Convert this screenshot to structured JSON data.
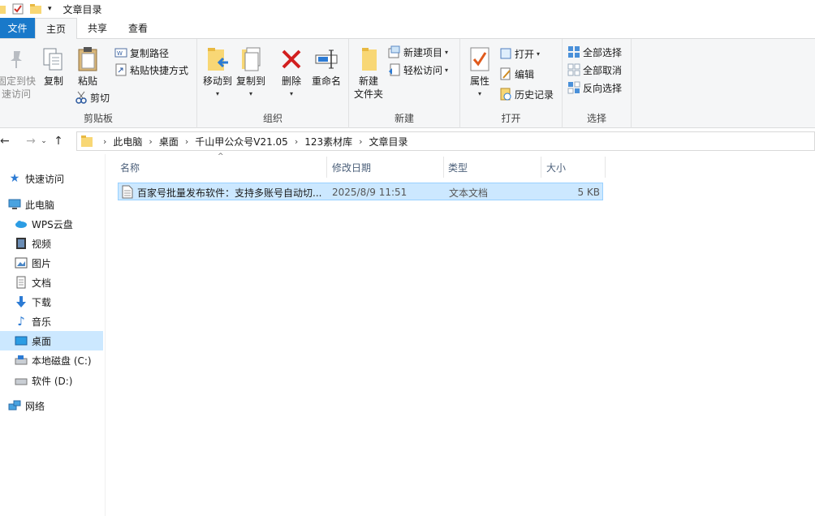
{
  "window": {
    "title": "文章目录"
  },
  "tabs": {
    "file": "文件",
    "home": "主页",
    "share": "共享",
    "view": "查看"
  },
  "ribbon": {
    "clipboard": {
      "pin": [
        "固定到快",
        "速访问"
      ],
      "copy": "复制",
      "paste": "粘贴",
      "copy_path": "复制路径",
      "paste_shortcut": "粘贴快捷方式",
      "cut": "剪切",
      "label": "剪贴板"
    },
    "organize": {
      "move_to": "移动到",
      "copy_to": "复制到",
      "delete": "删除",
      "rename": "重命名",
      "label": "组织"
    },
    "new": {
      "new_folder": [
        "新建",
        "文件夹"
      ],
      "new_item": "新建项目",
      "easy_access": "轻松访问",
      "label": "新建"
    },
    "open": {
      "properties": "属性",
      "open": "打开",
      "edit": "编辑",
      "history": "历史记录",
      "label": "打开"
    },
    "select": {
      "select_all": "全部选择",
      "select_none": "全部取消",
      "invert": "反向选择",
      "label": "选择"
    }
  },
  "address": {
    "crumbs": [
      "此电脑",
      "桌面",
      "千山甲公众号V21.05",
      "123素材库",
      "文章目录"
    ]
  },
  "nav": {
    "quick_access": "快速访问",
    "this_pc": "此电脑",
    "wps": "WPS云盘",
    "videos": "视频",
    "pictures": "图片",
    "documents": "文档",
    "downloads": "下载",
    "music": "音乐",
    "desktop": "桌面",
    "local_disk": "本地磁盘 (C:)",
    "software": "软件 (D:)",
    "network": "网络"
  },
  "columns": {
    "name": "名称",
    "modified": "修改日期",
    "type": "类型",
    "size": "大小"
  },
  "files": [
    {
      "name": "百家号批量发布软件：支持多账号自动切...",
      "modified": "2025/8/9 11:51",
      "type": "文本文档",
      "size": "5 KB"
    }
  ],
  "colors": {
    "accent": "#1979ca",
    "selection": "#cce8ff",
    "selection_border": "#99d1ff"
  }
}
